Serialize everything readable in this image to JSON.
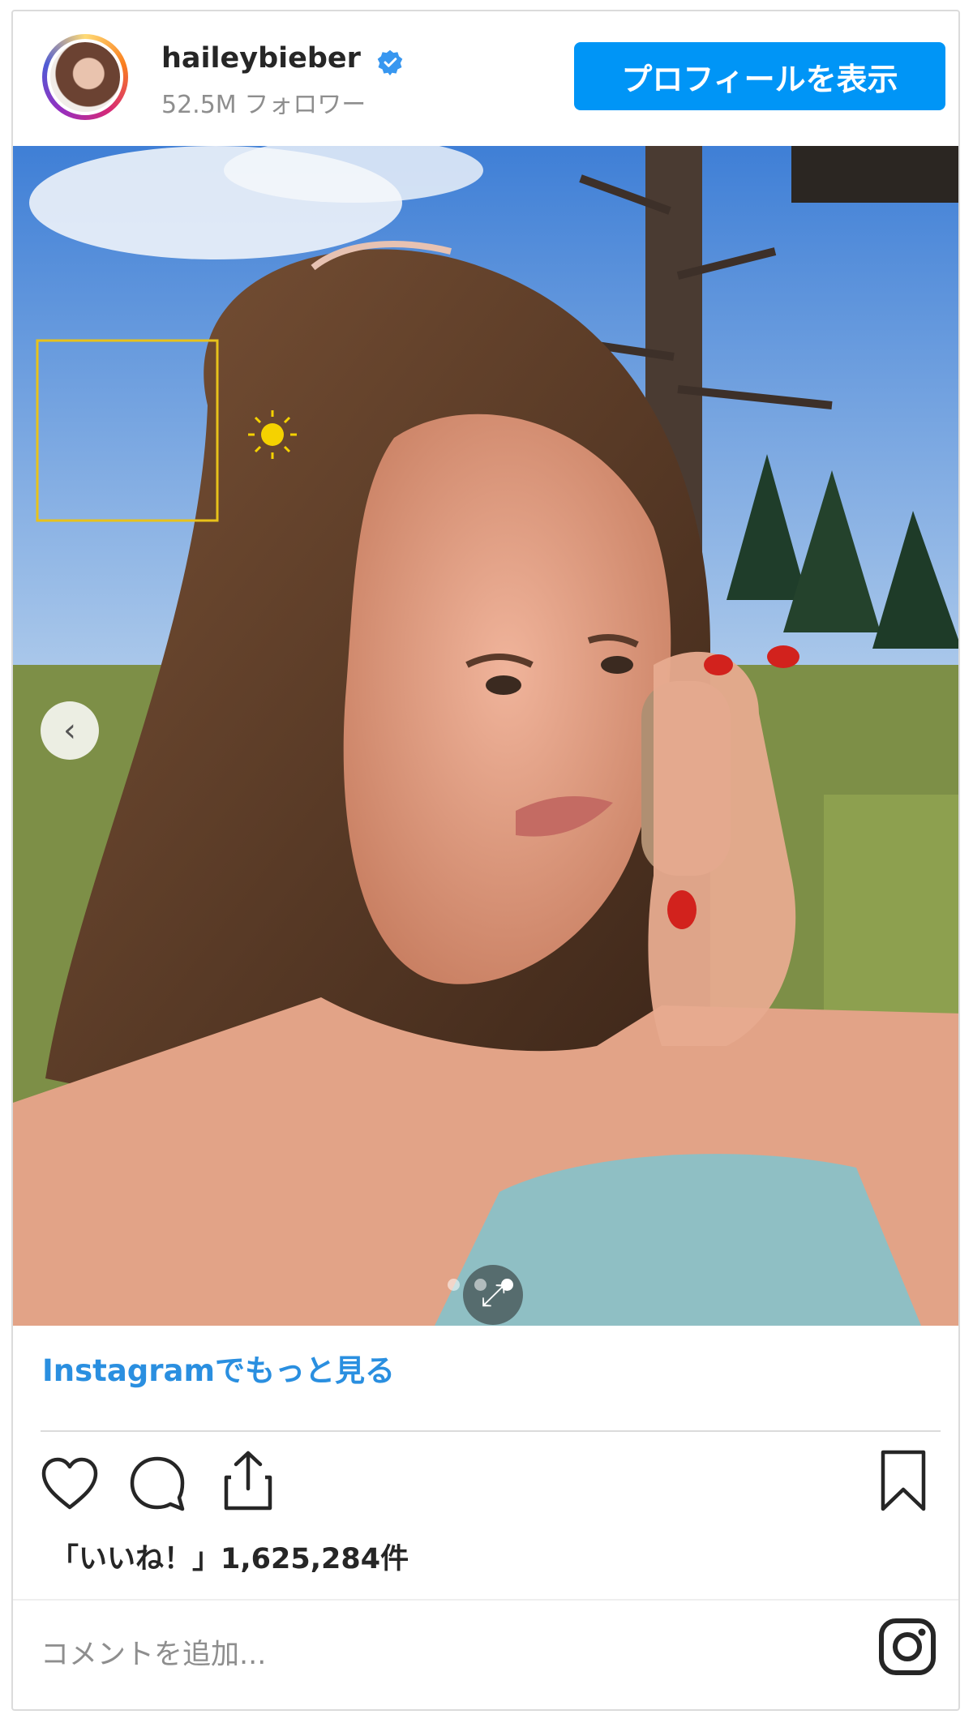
{
  "header": {
    "username": "haileybieber",
    "followers": "52.5M フォロワー",
    "profile_button": "プロフィールを表示"
  },
  "media": {
    "alt": "haileybieber post photo",
    "slide_count": 3,
    "active_slide": 3
  },
  "footer": {
    "more_link": "Instagramでもっと見る",
    "likes": "「いいね！」1,625,284件",
    "comment_placeholder": "コメントを追加..."
  },
  "colors": {
    "accent": "#0095f6",
    "link": "#2a8fe0",
    "text": "#262626",
    "muted": "#8e8e8e"
  }
}
